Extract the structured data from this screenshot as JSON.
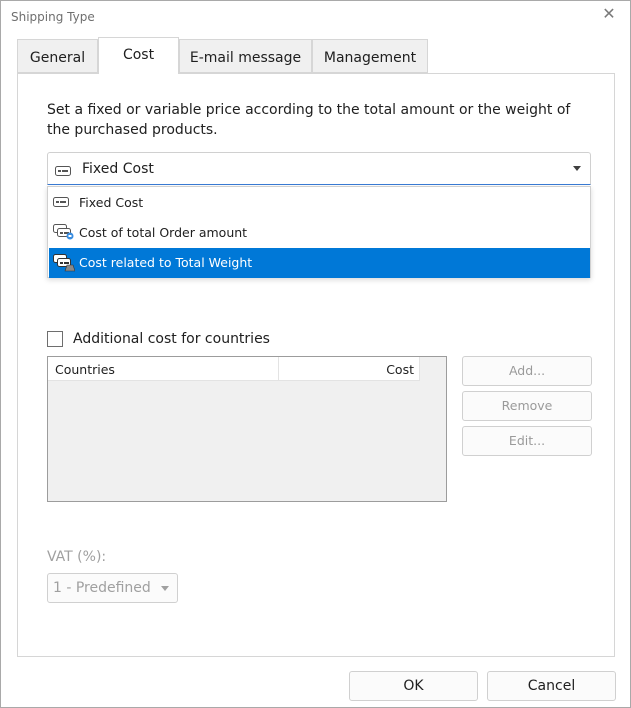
{
  "window": {
    "title": "Shipping Type"
  },
  "tabs": [
    {
      "label": "General"
    },
    {
      "label": "Cost"
    },
    {
      "label": "E-mail message"
    },
    {
      "label": "Management"
    }
  ],
  "cost_tab": {
    "description": "Set a fixed or variable price according to the total amount or the weight of the purchased products.",
    "cost_type": {
      "selected": "Fixed Cost",
      "options": [
        {
          "label": "Fixed Cost",
          "icon": "fixed-cost-icon"
        },
        {
          "label": "Cost of total Order amount",
          "icon": "order-amount-icon"
        },
        {
          "label": "Cost related to Total Weight",
          "icon": "weight-cost-icon",
          "highlighted": true
        }
      ]
    },
    "additional_cost": {
      "label": "Additional cost for countries",
      "checked": false,
      "columns": [
        "Countries",
        "Cost"
      ]
    },
    "buttons": {
      "add": "Add...",
      "remove": "Remove",
      "edit": "Edit..."
    },
    "vat": {
      "label": "VAT (%):",
      "selected": "1 - Predefined"
    }
  },
  "footer": {
    "ok": "OK",
    "cancel": "Cancel"
  },
  "colors": {
    "accent": "#0078d7",
    "disabled_text": "#9a9a9a"
  }
}
